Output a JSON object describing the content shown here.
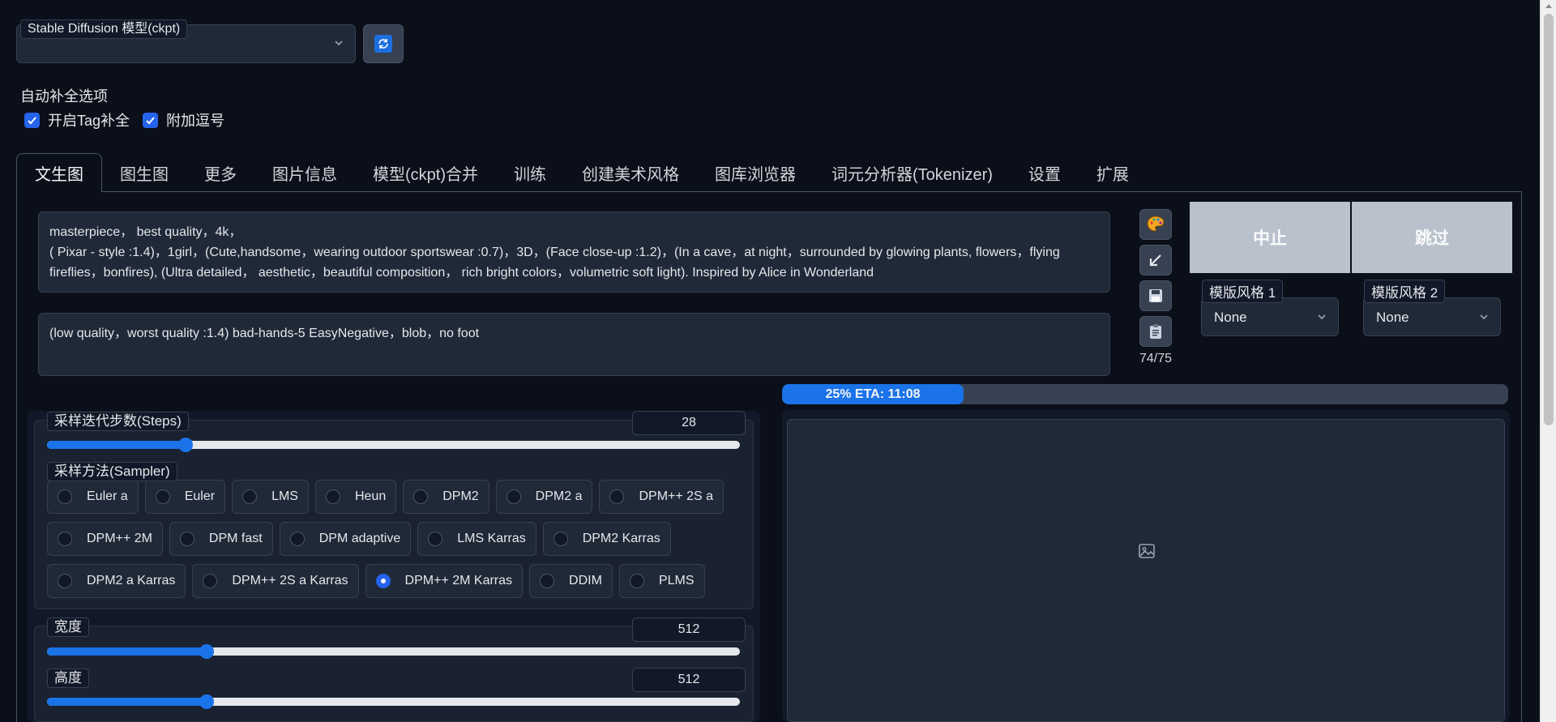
{
  "model": {
    "label": "Stable Diffusion 模型(ckpt)",
    "value": ""
  },
  "autocomplete": {
    "title": "自动补全选项",
    "tag_label": "开启Tag补全",
    "comma_label": "附加逗号"
  },
  "tabs": [
    "文生图",
    "图生图",
    "更多",
    "图片信息",
    "模型(ckpt)合并",
    "训练",
    "创建美术风格",
    "图库浏览器",
    "词元分析器(Tokenizer)",
    "设置",
    "扩展"
  ],
  "prompt": {
    "positive_line1": "masterpiece， best quality，4k，",
    "positive_line2": "( Pixar - style :1.4)，1girl，(Cute,handsome，wearing outdoor sportswear :0.7)，3D，(Face close-up :1.2)，(In a cave，at night，surrounded by glowing plants, flowers，flying",
    "positive_line3": "fireflies，bonfires), (Ultra detailed， aesthetic，beautiful composition， rich bright colors，volumetric soft light). Inspired by Alice in Wonderland",
    "negative": "(low quality，worst quality :1.4) bad-hands-5 EasyNegative，blob，no foot",
    "counter": "74/75"
  },
  "actions": {
    "interrupt": "中止",
    "skip": "跳过"
  },
  "styles": {
    "style1_label": "模版风格 1",
    "style1_value": "None",
    "style2_label": "模版风格 2",
    "style2_value": "None"
  },
  "progress": {
    "text": "25% ETA: 11:08",
    "fraction": 0.25
  },
  "steps": {
    "label": "采样迭代步数(Steps)",
    "value": "28",
    "fraction": 0.2
  },
  "sampler": {
    "label": "采样方法(Sampler)",
    "rows": [
      [
        "Euler a",
        "Euler",
        "LMS",
        "Heun",
        "DPM2",
        "DPM2 a",
        "DPM++ 2S a"
      ],
      [
        "DPM++ 2M",
        "DPM fast",
        "DPM adaptive",
        "LMS Karras",
        "DPM2 Karras"
      ],
      [
        "DPM2 a Karras",
        "DPM++ 2S a Karras",
        "DPM++ 2M Karras",
        "DDIM",
        "PLMS"
      ]
    ],
    "selected": "DPM++ 2M Karras"
  },
  "width": {
    "label": "宽度",
    "value": "512",
    "fraction": 0.23
  },
  "height": {
    "label": "高度",
    "value": "512",
    "fraction": 0.23
  },
  "colors": {
    "accent": "#1a73e8",
    "background": "#0b0f19",
    "button_disabled": "#b9c1cc"
  }
}
